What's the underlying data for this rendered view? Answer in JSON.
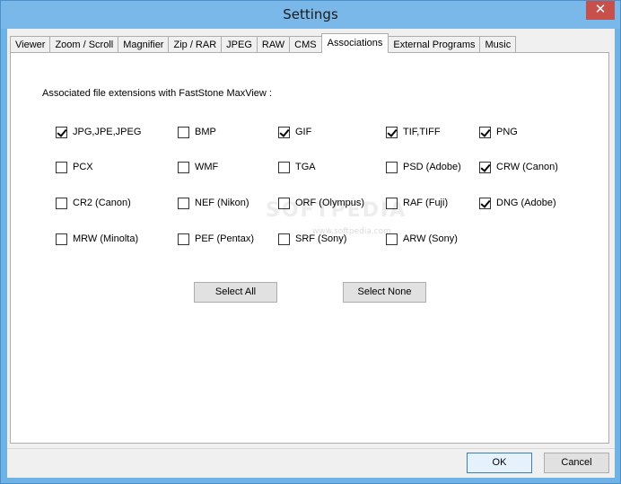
{
  "window": {
    "title": "Settings",
    "close_glyph": "✕"
  },
  "tabs": [
    {
      "label": "Viewer",
      "active": false
    },
    {
      "label": "Zoom / Scroll",
      "active": false
    },
    {
      "label": "Magnifier",
      "active": false
    },
    {
      "label": "Zip / RAR",
      "active": false
    },
    {
      "label": "JPEG",
      "active": false
    },
    {
      "label": "RAW",
      "active": false
    },
    {
      "label": "CMS",
      "active": false
    },
    {
      "label": "Associations",
      "active": true
    },
    {
      "label": "External Programs",
      "active": false
    },
    {
      "label": "Music",
      "active": false
    }
  ],
  "associations": {
    "heading": "Associated file extensions with FastStone MaxView :",
    "items": [
      {
        "label": "JPG,JPE,JPEG",
        "checked": true
      },
      {
        "label": "BMP",
        "checked": false
      },
      {
        "label": "GIF",
        "checked": true
      },
      {
        "label": "TIF,TIFF",
        "checked": true
      },
      {
        "label": "PNG",
        "checked": true
      },
      {
        "label": "PCX",
        "checked": false
      },
      {
        "label": "WMF",
        "checked": false
      },
      {
        "label": "TGA",
        "checked": false
      },
      {
        "label": "PSD (Adobe)",
        "checked": false
      },
      {
        "label": "CRW (Canon)",
        "checked": true
      },
      {
        "label": "CR2 (Canon)",
        "checked": false
      },
      {
        "label": "NEF (Nikon)",
        "checked": false
      },
      {
        "label": "ORF (Olympus)",
        "checked": false
      },
      {
        "label": "RAF (Fuji)",
        "checked": false
      },
      {
        "label": "DNG (Adobe)",
        "checked": true
      },
      {
        "label": "MRW (Minolta)",
        "checked": false
      },
      {
        "label": "PEF (Pentax)",
        "checked": false
      },
      {
        "label": "SRF (Sony)",
        "checked": false
      },
      {
        "label": "ARW (Sony)",
        "checked": false
      }
    ],
    "select_all_label": "Select All",
    "select_none_label": "Select None"
  },
  "footer": {
    "ok_label": "OK",
    "cancel_label": "Cancel"
  },
  "watermark": {
    "text": "SOFTPEDIA",
    "sub": "www.softpedia.com"
  }
}
